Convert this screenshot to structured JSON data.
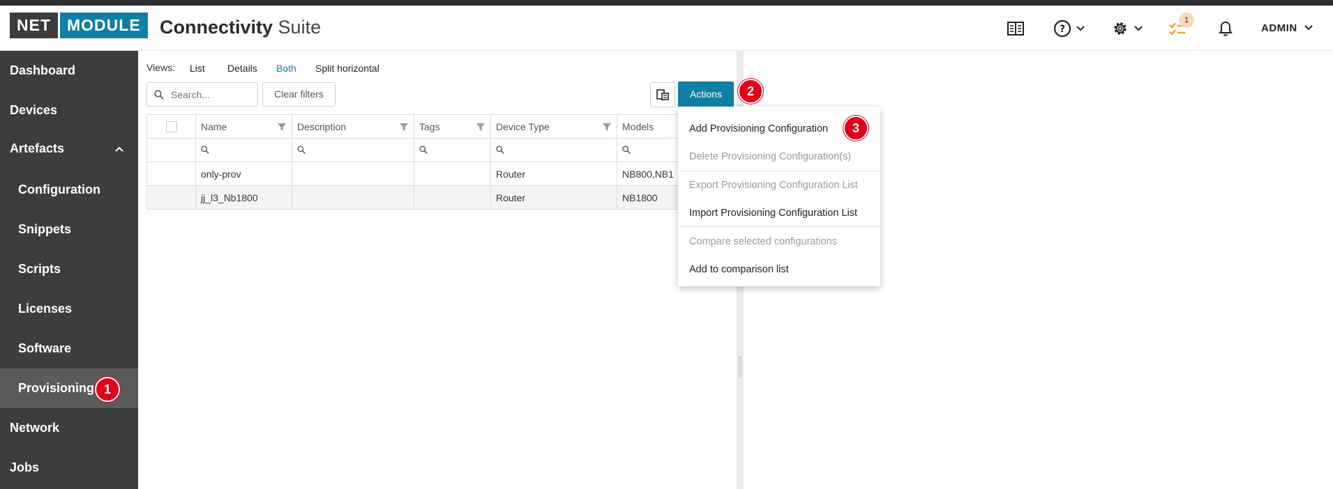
{
  "header": {
    "logo_left": "NET",
    "logo_right": "MODULE",
    "title_bold": "Connectivity",
    "title_light": "Suite",
    "task_badge": "1",
    "user": "ADMIN"
  },
  "sidebar": {
    "items": [
      {
        "label": "Dashboard"
      },
      {
        "label": "Devices"
      },
      {
        "label": "Artefacts"
      },
      {
        "label": "Configuration"
      },
      {
        "label": "Snippets"
      },
      {
        "label": "Scripts"
      },
      {
        "label": "Licenses"
      },
      {
        "label": "Software"
      },
      {
        "label": "Provisioning"
      },
      {
        "label": "Network"
      },
      {
        "label": "Jobs"
      }
    ]
  },
  "markers": {
    "m1": "1",
    "m2": "2",
    "m3": "3"
  },
  "toolbar": {
    "views_label": "Views:",
    "views": [
      "List",
      "Details",
      "Both",
      "Split horizontal"
    ],
    "selected_view": "Both",
    "search_placeholder": "Search...",
    "clear_filters": "Clear filters",
    "actions": "Actions"
  },
  "table": {
    "columns": [
      "Name",
      "Description",
      "Tags",
      "Device Type",
      "Models"
    ],
    "rows": [
      [
        "only-prov",
        "",
        "",
        "Router",
        "NB800,NB1"
      ],
      [
        "jj_l3_Nb1800",
        "",
        "",
        "Router",
        "NB1800"
      ]
    ]
  },
  "actions_menu": {
    "items": [
      {
        "label": "Add Provisioning Configuration",
        "enabled": true
      },
      {
        "label": "Delete Provisioning Configuration(s)",
        "enabled": false
      },
      {
        "label": "Export Provisioning Configuration List",
        "enabled": false
      },
      {
        "label": "Import Provisioning Configuration List",
        "enabled": true
      },
      {
        "label": "Compare selected configurations",
        "enabled": false
      },
      {
        "label": "Add to comparison list",
        "enabled": true
      }
    ]
  },
  "colors": {
    "brand": "#0e7fa5",
    "sidebar": "#3d3d3d",
    "marker": "#e3001b",
    "task_icon": "#f59c1a"
  }
}
